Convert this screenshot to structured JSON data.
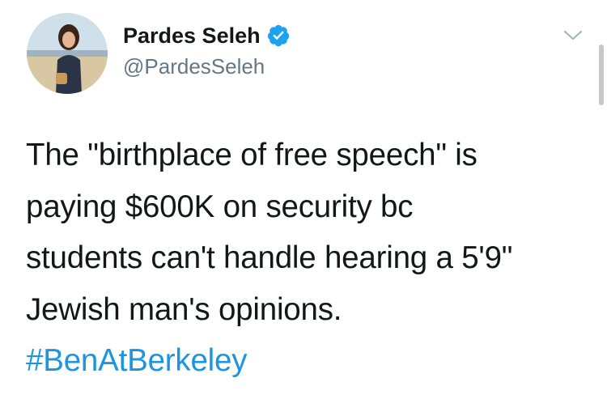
{
  "tweet": {
    "display_name": "Pardes Seleh",
    "handle": "@PardesSeleh",
    "lines": [
      "The \"birthplace of free speech\" is",
      "paying $600K on security bc",
      "students can't handle hearing a 5'9\"",
      "Jewish man's opinions."
    ],
    "hashtag": "#BenAtBerkeley"
  },
  "icons": {
    "verified": "verified-badge-icon",
    "menu": "chevron-down-icon"
  },
  "colors": {
    "text": "#14171a",
    "secondary": "#657786",
    "link": "#1b95e0",
    "verified": "#1da1f2"
  }
}
